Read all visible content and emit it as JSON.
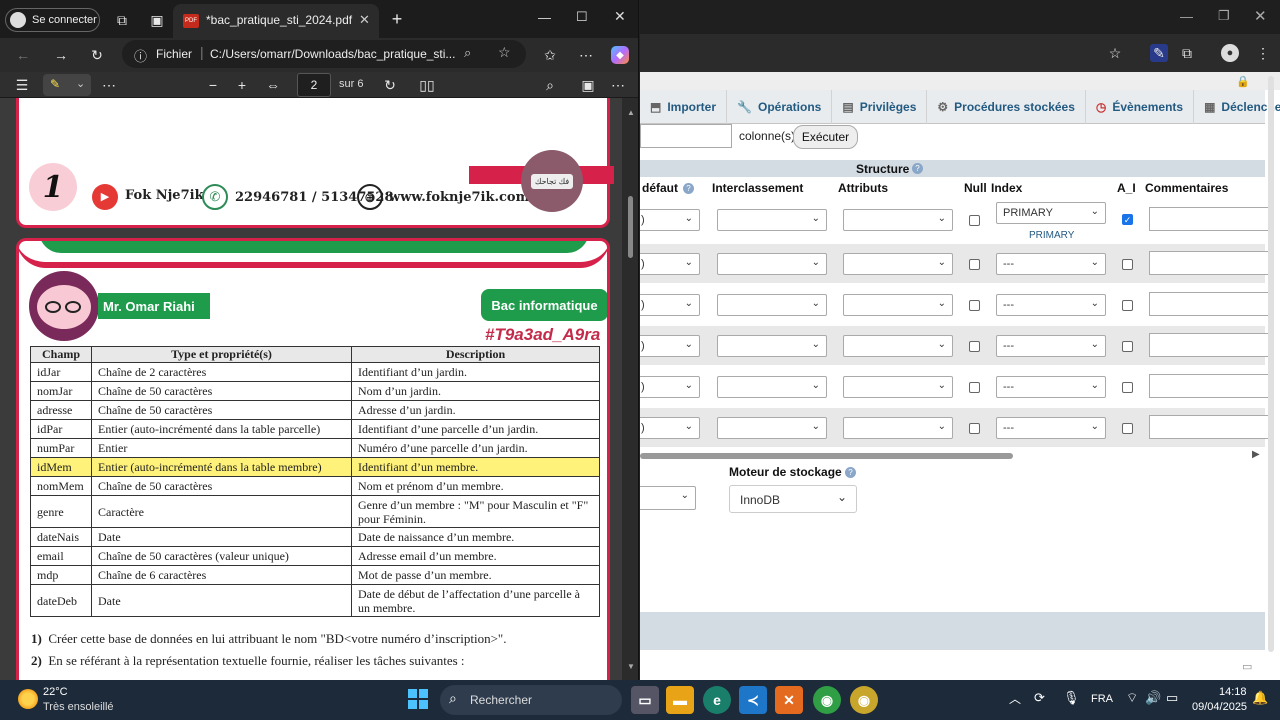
{
  "edge": {
    "profile_label": "Se connecter",
    "tab_title": "*bac_pratique_sti_2024.pdf",
    "tab_badge": "PDF",
    "addr_prefix": "Fichier",
    "addr_url": "C:/Users/omarr/Downloads/bac_pratique_sti...",
    "page_current": "2",
    "page_total": "sur 6"
  },
  "pdf_header": {
    "logo_number": "1",
    "brand": "Fok Nje7ik",
    "phones": "22946781 / 51347528",
    "website": "www.foknje7ik.com",
    "badge_text": "فك تجاحك"
  },
  "pdf_page": {
    "author": "Mr. Omar Riahi",
    "subject_badge": "Bac informatique",
    "hashtag": "#T9a3ad_A9ra",
    "table": {
      "headers": [
        "Champ",
        "Type et propriété(s)",
        "Description"
      ],
      "rows": [
        {
          "champ": "idJar",
          "type": "Chaîne de 2 caractères",
          "desc": "Identifiant d’un jardin."
        },
        {
          "champ": "nomJar",
          "type": "Chaîne de 50 caractères",
          "desc": "Nom d’un jardin."
        },
        {
          "champ": "adresse",
          "type": "Chaîne de 50 caractères",
          "desc": "Adresse d’un jardin."
        },
        {
          "champ": "idPar",
          "type": "Entier (auto-incrémenté dans la table parcelle)",
          "desc": "Identifiant d’une parcelle d’un jardin."
        },
        {
          "champ": "numPar",
          "type": "Entier",
          "desc": "Numéro d’une parcelle d’un jardin."
        },
        {
          "champ": "idMem",
          "type": "Entier (auto-incrémenté dans la table membre)",
          "desc": "Identifiant d’un membre."
        },
        {
          "champ": "nomMem",
          "type": "Chaîne de 50 caractères",
          "desc": "Nom et prénom d’un membre."
        },
        {
          "champ": "genre",
          "type": "Caractère",
          "desc": "Genre d’un membre : \"M\" pour Masculin et \"F\" pour Féminin."
        },
        {
          "champ": "dateNais",
          "type": "Date",
          "desc": "Date de naissance d’un membre."
        },
        {
          "champ": "email",
          "type": "Chaîne de 50 caractères (valeur unique)",
          "desc": "Adresse email d’un membre."
        },
        {
          "champ": "mdp",
          "type": "Chaîne de 6 caractères",
          "desc": "Mot de passe d’un membre."
        },
        {
          "champ": "dateDeb",
          "type": "Date",
          "desc": "Date de début de l’affectation d’une parcelle à un membre."
        }
      ]
    },
    "q1_num": "1)",
    "q1_text": "Créer cette base de données en lui attribuant le nom \"BD<votre numéro d’inscription>\".",
    "q2_num": "2)",
    "q2_text": "En se référant à la représentation textuelle fournie, réaliser les tâches suivantes :"
  },
  "pma": {
    "tabs": [
      {
        "label": "Importer",
        "icon": "⬒"
      },
      {
        "label": "Opérations",
        "icon": "🔧"
      },
      {
        "label": "Privilèges",
        "icon": "▤"
      },
      {
        "label": "Procédures stockées",
        "icon": "⚙"
      },
      {
        "label": "Évènements",
        "icon": "◷"
      },
      {
        "label": "Déclencheurs",
        "icon": "▦"
      }
    ],
    "columns_label": "colonne(s)",
    "execute_label": "Exécuter",
    "structure_label": "Structure",
    "headers": {
      "defaut": "défaut",
      "interclassement": "Interclassement",
      "attributs": "Attributs",
      "null": "Null",
      "index": "Index",
      "ai": "A_I",
      "commentaires": "Commentaires"
    },
    "row1_index": "PRIMARY",
    "row1_index_note": "PRIMARY",
    "other_index": "---",
    "engine_label": "Moteur de stockage :",
    "engine_value": "InnoDB"
  },
  "taskbar": {
    "temp": "22°C",
    "weather": "Très ensoleillé",
    "search": "Rechercher",
    "lang": "FRA",
    "time": "14:18",
    "date": "09/04/2025"
  }
}
